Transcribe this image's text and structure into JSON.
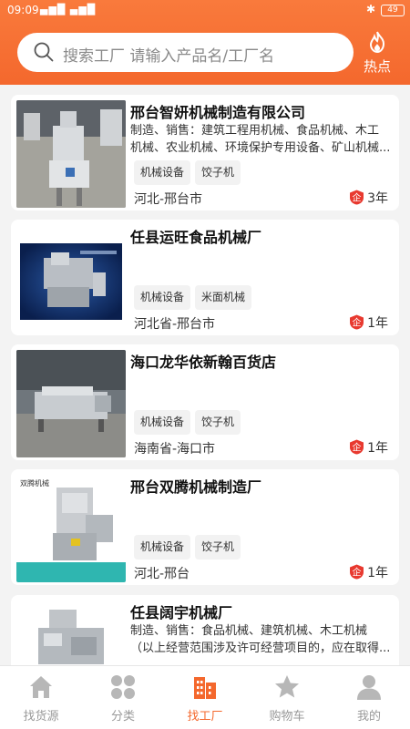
{
  "status": {
    "time": "09:09",
    "signal": "▄▆█ ▄▆█",
    "bluetooth": "✱",
    "battery": "49"
  },
  "search": {
    "placeholder": "搜索工厂 请输入产品名/工厂名"
  },
  "hot": {
    "label": "热点"
  },
  "factories": [
    {
      "title": "邢台智妍机械制造有限公司",
      "desc1": "制造、销售：建筑工程用机械、食品机械、木工",
      "desc2": "机械、农业机械、环境保护专用设备、矿山机械...",
      "tags": [
        "机械设备",
        "饺子机"
      ],
      "location": "河北-邢台市",
      "years": "3年"
    },
    {
      "title": "任县运旺食品机械厂",
      "tags": [
        "机械设备",
        "米面机械"
      ],
      "location": "河北省-邢台市",
      "years": "1年"
    },
    {
      "title": "海口龙华依新翰百货店",
      "tags": [
        "机械设备",
        "饺子机"
      ],
      "location": "海南省-海口市",
      "years": "1年"
    },
    {
      "title": "邢台双腾机械制造厂",
      "tags": [
        "机械设备",
        "饺子机"
      ],
      "location": "河北-邢台",
      "years": "1年",
      "thumb_text": "双腾机械"
    },
    {
      "title": "任县阔宇机械厂",
      "desc1": "制造、销售：食品机械、建筑机械、木工机械",
      "desc2": "（以上经营范围涉及许可经营项目的，应在取得..."
    }
  ],
  "badge": {
    "qi": "企"
  },
  "nav": [
    {
      "label": "找货源",
      "icon": "home-icon"
    },
    {
      "label": "分类",
      "icon": "grid-icon"
    },
    {
      "label": "找工厂",
      "icon": "factory-icon"
    },
    {
      "label": "购物车",
      "icon": "star-icon"
    },
    {
      "label": "我的",
      "icon": "user-icon"
    }
  ],
  "colors": {
    "accent": "#f4682d",
    "badge": "#e8392f"
  }
}
